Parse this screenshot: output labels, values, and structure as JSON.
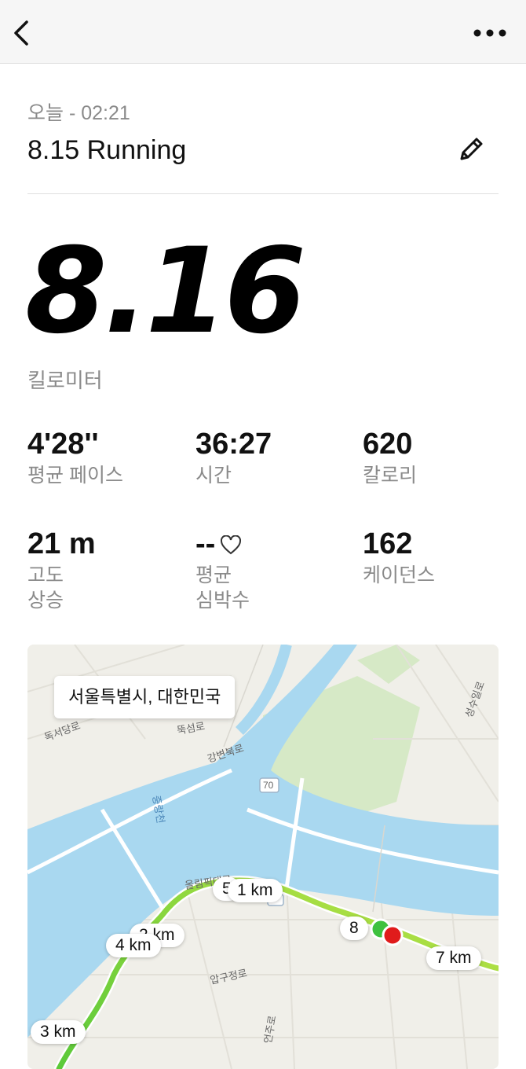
{
  "header": {
    "back_icon": "chevron-left-icon",
    "more_icon": "more-horizontal-icon"
  },
  "activity": {
    "date": "오늘 - 02:21",
    "title": "8.15 Running",
    "edit_icon": "pencil-icon",
    "distance": "8.16",
    "distance_unit": "킬로미터"
  },
  "stats": [
    {
      "value": "4'28''",
      "label": "평균 페이스"
    },
    {
      "value": "36:27",
      "label": "시간"
    },
    {
      "value": "620",
      "label": "칼로리"
    },
    {
      "value": "21 m",
      "label": "고도\n상승"
    },
    {
      "value": "--",
      "label": "평균\n심박수",
      "icon": "heart-outline-icon"
    },
    {
      "value": "162",
      "label": "케이던스"
    }
  ],
  "map": {
    "location": "서울특별시, 대한민국",
    "km_markers": [
      "1 km",
      "3 km",
      "4 km",
      "7 km",
      "8",
      "5",
      "2 km"
    ],
    "road_labels": [
      "강변북로",
      "올림픽대로",
      "압구정로",
      "독서당로",
      "뚝섬로",
      "성수일로",
      "언주로",
      "중랑천",
      "70"
    ],
    "colors": {
      "water": "#a9d8f0",
      "land": "#f0efe9",
      "park": "#d6e9c6",
      "route_start": "#5cc93a",
      "route_end": "#d4e84a",
      "start_marker": "#3ec13e",
      "end_marker": "#e01b1b"
    }
  }
}
